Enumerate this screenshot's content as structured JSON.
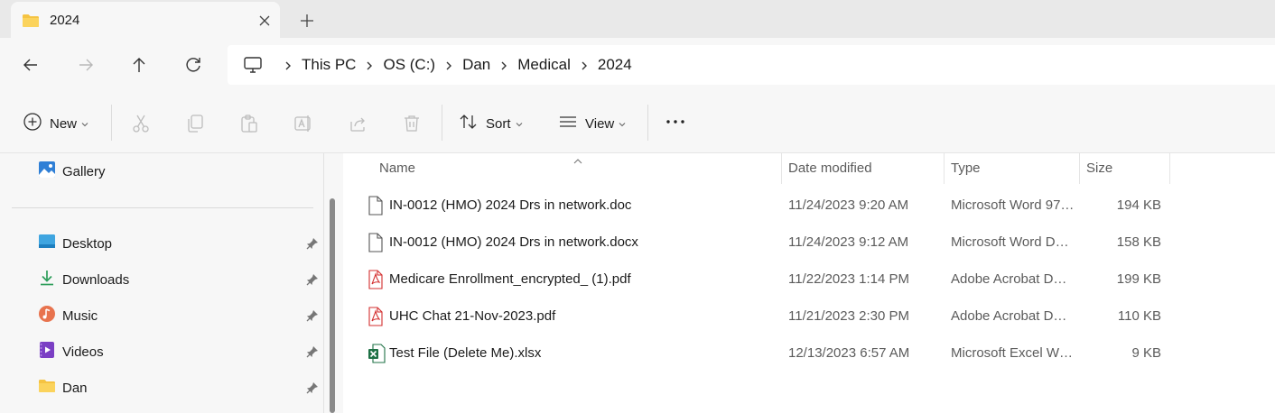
{
  "tab": {
    "title": "2024",
    "icon": "folder-icon"
  },
  "breadcrumb": [
    "This PC",
    "OS (C:)",
    "Dan",
    "Medical",
    "2024"
  ],
  "toolbar": {
    "new_label": "New",
    "sort_label": "Sort",
    "view_label": "View"
  },
  "sidebar": {
    "gallery": "Gallery",
    "items": [
      {
        "label": "Desktop",
        "icon": "desktop-icon",
        "pinned": true
      },
      {
        "label": "Downloads",
        "icon": "downloads-icon",
        "pinned": true
      },
      {
        "label": "Music",
        "icon": "music-icon",
        "pinned": true
      },
      {
        "label": "Videos",
        "icon": "videos-icon",
        "pinned": true
      },
      {
        "label": "Dan",
        "icon": "folder-icon",
        "pinned": true
      }
    ]
  },
  "columns": {
    "name": "Name",
    "date": "Date modified",
    "type": "Type",
    "size": "Size"
  },
  "files": [
    {
      "name": "IN-0012 (HMO) 2024 Drs in network.doc",
      "date": "11/24/2023 9:20 AM",
      "type": "Microsoft Word 97…",
      "size": "194 KB",
      "icon": "document-icon"
    },
    {
      "name": "IN-0012 (HMO) 2024 Drs in network.docx",
      "date": "11/24/2023 9:12 AM",
      "type": "Microsoft Word D…",
      "size": "158 KB",
      "icon": "document-icon"
    },
    {
      "name": "Medicare Enrollment_encrypted_ (1).pdf",
      "date": "11/22/2023 1:14 PM",
      "type": "Adobe Acrobat D…",
      "size": "199 KB",
      "icon": "pdf-icon"
    },
    {
      "name": "UHC Chat 21-Nov-2023.pdf",
      "date": "11/21/2023 2:30 PM",
      "type": "Adobe Acrobat D…",
      "size": "110 KB",
      "icon": "pdf-icon"
    },
    {
      "name": "Test File (Delete Me).xlsx",
      "date": "12/13/2023 6:57 AM",
      "type": "Microsoft Excel W…",
      "size": "9 KB",
      "icon": "excel-icon"
    }
  ],
  "colors": {
    "folder": "#f5c342",
    "pdf_red": "#d32f2f",
    "excel_green": "#1e7145",
    "accent": "#0067c0"
  }
}
